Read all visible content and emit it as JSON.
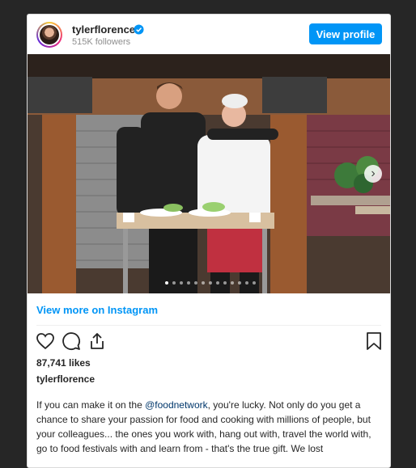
{
  "colors": {
    "accent": "#0095f6",
    "text": "#262626",
    "muted": "#8e8e8e",
    "background": "#262626"
  },
  "header": {
    "username": "tylerflorence",
    "followers": "515K followers",
    "view_profile_label": "View profile",
    "verified_icon": "verified-badge-icon",
    "avatar_icon": "profile-avatar"
  },
  "post": {
    "carousel_dots_total": 13,
    "carousel_active_index": 0,
    "next_icon": "chevron-right-icon",
    "view_more_label": "View more on Instagram",
    "actions": [
      "heart-icon",
      "comment-icon",
      "share-icon",
      "bookmark-icon"
    ],
    "likes": "87,741 likes",
    "caption_user": "tylerflorence",
    "caption_before": "If you can make it on the ",
    "caption_mention": "@foodnetwork",
    "caption_after": ", you're lucky. Not only do you get a chance to share your passion for food and cooking with millions of people, but your colleagues... the ones you work with, hang out with, travel the world with, go to food festivals with and learn from - that's the true gift. We lost"
  }
}
